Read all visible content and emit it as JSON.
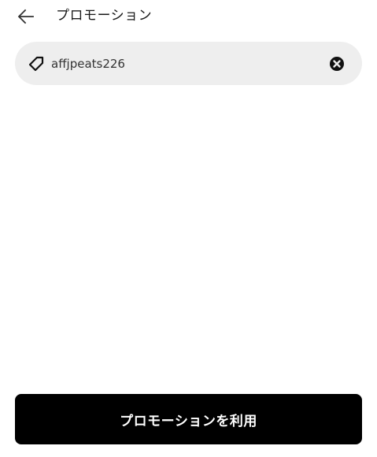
{
  "header": {
    "back_icon": "arrow-left-icon",
    "title": "プロモーション"
  },
  "promo_field": {
    "leading_icon": "tag-icon",
    "value": "affjpeats226",
    "clear_icon": "clear-circle-x-icon"
  },
  "apply_button": {
    "label": "プロモーションを利用"
  },
  "colors": {
    "background": "#ffffff",
    "field_background": "#eeeeee",
    "button_background": "#000000",
    "button_text": "#ffffff"
  }
}
